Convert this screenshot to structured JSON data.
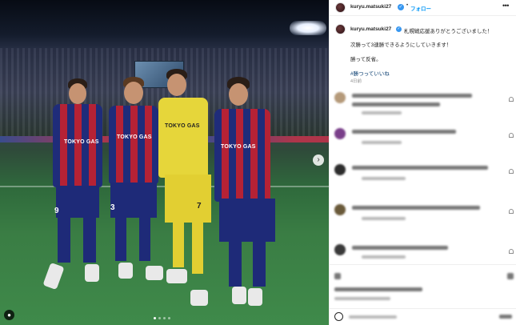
{
  "header": {
    "username": "kuryu.matsuki27",
    "separator": "•",
    "follow_label": "フォロー",
    "more_label": "•••"
  },
  "caption": {
    "username": "kuryu.matsuki27",
    "line1": "札幌戦応援ありがとうございました！",
    "line2": "次勝って3連勝できるようにしていきます！",
    "line3": "勝って反省。",
    "hashtag": "#勝つっていいね",
    "timestamp": "4日前"
  },
  "photo": {
    "sponsor_text": "TOKYO GAS",
    "gk_sponsor_text": "TOKYO GAS",
    "number_left": "9",
    "number_mid": "3",
    "number_gk": "7",
    "carousel_next": "›",
    "user_tag": "●",
    "dots_count": 4
  },
  "colors": {
    "follow": "#0095f6",
    "verified": "#3897f0",
    "hashtag": "#00376b",
    "fc_blue": "#1f2c7a",
    "fc_red": "#b52235",
    "gk_yellow": "#e6d63a"
  },
  "icons": {
    "verified": "verified-badge-icon",
    "more": "more-options-icon",
    "carousel": "chevron-right-icon",
    "user_tag": "person-tag-icon",
    "emoji": "emoji-icon"
  }
}
